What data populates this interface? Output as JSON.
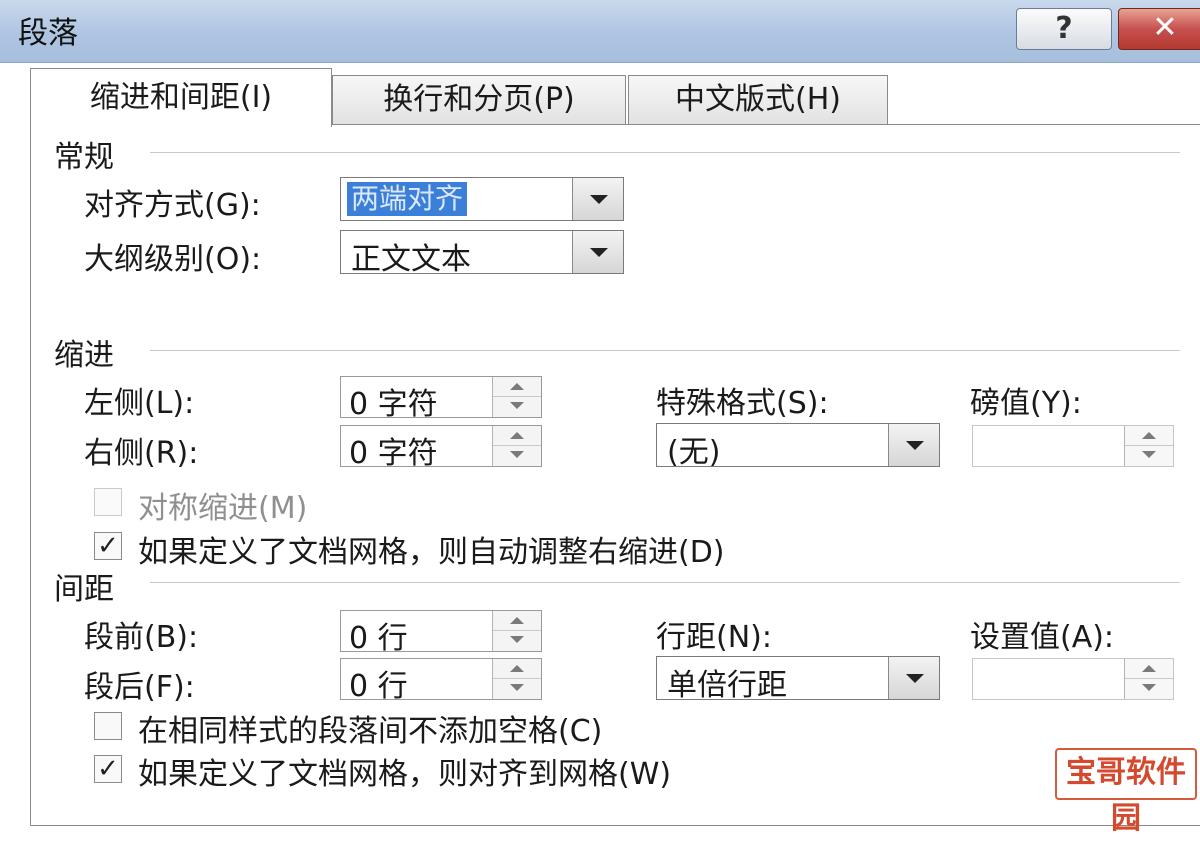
{
  "window": {
    "title": "段落",
    "help_label": "?",
    "close_label": "✕"
  },
  "tabs": [
    {
      "label": "缩进和间距(I)",
      "active": true
    },
    {
      "label": "换行和分页(P)",
      "active": false
    },
    {
      "label": "中文版式(H)",
      "active": false
    }
  ],
  "general": {
    "heading": "常规",
    "alignment_label": "对齐方式(G):",
    "alignment_value": "两端对齐",
    "outline_label": "大纲级别(O):",
    "outline_value": "正文文本"
  },
  "indent": {
    "heading": "缩进",
    "left_label": "左侧(L):",
    "left_value": "0 字符",
    "right_label": "右侧(R):",
    "right_value": "0 字符",
    "special_label": "特殊格式(S):",
    "special_value": "(无)",
    "amount_label": "磅值(Y):",
    "amount_value": "",
    "mirror_label": "对称缩进(M)",
    "mirror_checked": false,
    "auto_right_label": "如果定义了文档网格，则自动调整右缩进(D)",
    "auto_right_checked": true
  },
  "spacing": {
    "heading": "间距",
    "before_label": "段前(B):",
    "before_value": "0 行",
    "after_label": "段后(F):",
    "after_value": "0 行",
    "line_label": "行距(N):",
    "line_value": "单倍行距",
    "at_label": "设置值(A):",
    "at_value": "",
    "no_space_label": "在相同样式的段落间不添加空格(C)",
    "no_space_checked": false,
    "snap_grid_label": "如果定义了文档网格，则对齐到网格(W)",
    "snap_grid_checked": true
  },
  "watermark": {
    "text": "宝哥软件园"
  },
  "icons": {
    "check": "✓"
  }
}
